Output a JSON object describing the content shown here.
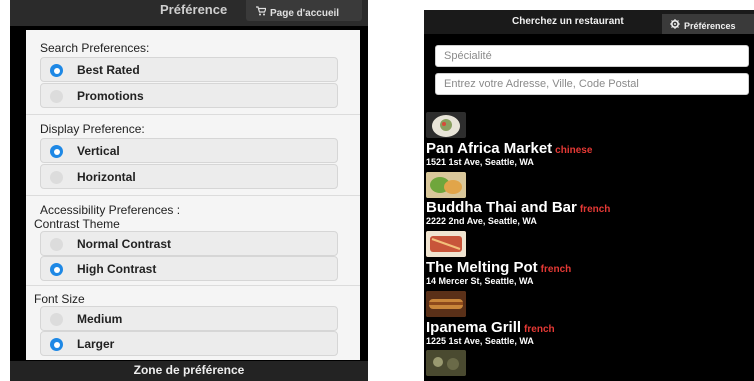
{
  "left": {
    "header_title": "Préférence",
    "home_button": "Page d'accueil",
    "home_icon": "cart-icon",
    "search_title": "Search Preferences:",
    "search_options": [
      {
        "label": "Best Rated",
        "selected": true
      },
      {
        "label": "Promotions",
        "selected": false
      }
    ],
    "display_title": "Display Preference:",
    "display_options": [
      {
        "label": "Vertical",
        "selected": true
      },
      {
        "label": "Horizontal",
        "selected": false
      }
    ],
    "access_title": "Accessibility Preferences :",
    "contrast_title": "Contrast Theme",
    "contrast_options": [
      {
        "label": "Normal Contrast",
        "selected": false
      },
      {
        "label": "High Contrast",
        "selected": true
      }
    ],
    "font_title": "Font Size",
    "font_options": [
      {
        "label": "Medium",
        "selected": false
      },
      {
        "label": "Larger",
        "selected": true
      }
    ],
    "footer": "Zone de préférence"
  },
  "right": {
    "title": "Cherchez un restaurant",
    "pref_button": "Préférences",
    "pref_icon": "gear-icon",
    "specialty_placeholder": "Spécialité",
    "address_placeholder": "Entrez votre Adresse, Ville, Code Postal",
    "restaurants": [
      {
        "name": "Pan Africa Market",
        "cuisine": "chinese",
        "address": "1521 1st Ave, Seattle, WA",
        "thumb_color": "#c9b07a"
      },
      {
        "name": "Buddha Thai and Bar",
        "cuisine": "french",
        "address": "2222 2nd Ave, Seattle, WA",
        "thumb_color": "#7ea84a"
      },
      {
        "name": "The Melting Pot",
        "cuisine": "french",
        "address": "14 Mercer St, Seattle, WA",
        "thumb_color": "#c8553a"
      },
      {
        "name": "Ipanema Grill",
        "cuisine": "french",
        "address": "1225 1st Ave, Seattle, WA",
        "thumb_color": "#b3692f"
      }
    ]
  },
  "colors": {
    "accent": "#1e88e5",
    "cuisine": "#e53935"
  }
}
